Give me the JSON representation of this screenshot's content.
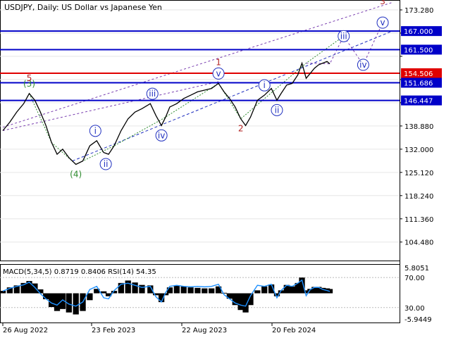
{
  "window": {
    "title": "USDJPY, Daily:  US Dollar vs Japanese Yen"
  },
  "colors": {
    "background": "#ffffff",
    "price_line": "#000000",
    "horizontal_level": "#0000c8",
    "highlight_level": "#e00000",
    "wave_red": "#b22222",
    "wave_green": "#2e8b2e",
    "wave_blue": "#1f2fbf",
    "channel_purple": "#7a3fb0",
    "macd_hist": "#000000",
    "rsi_line": "#1e90ff"
  },
  "chart_data": {
    "type": "line",
    "symbol": "USDJPY",
    "timeframe": "Daily",
    "ylim": [
      99.0,
      176.0
    ],
    "yticks": [
      173.28,
      166.4,
      159.52,
      152.64,
      145.76,
      138.88,
      132.0,
      125.12,
      118.24,
      111.36,
      104.48
    ],
    "ytick_labels": [
      "173.280",
      "167.000",
      "161.500",
      "154.506",
      "151.686",
      "146.447",
      "138.880",
      "132.000",
      "125.120",
      "118.240",
      "111.360",
      "104.480"
    ],
    "xticks": [
      "26 Aug 2022",
      "23 Feb 2023",
      "22 Aug 2023",
      "20 Feb 2024"
    ],
    "x_range": [
      0,
      470
    ],
    "series": [
      {
        "name": "USDJPY",
        "x": [
          0,
          10,
          20,
          30,
          38,
          46,
          54,
          62,
          70,
          78,
          86,
          95,
          105,
          115,
          125,
          135,
          145,
          152,
          160,
          170,
          180,
          190,
          200,
          212,
          220,
          228,
          234,
          240,
          250,
          260,
          270,
          280,
          290,
          300,
          310,
          318,
          326,
          334,
          342,
          349,
          356,
          366,
          376,
          386,
          394,
          400,
          408,
          416,
          424,
          430,
          436,
          442,
          448,
          454,
          460,
          466,
          470
        ],
        "y": [
          137.5,
          140.0,
          143.0,
          145.5,
          148.5,
          146.5,
          143.0,
          139.0,
          134.0,
          130.5,
          132.0,
          129.5,
          127.5,
          128.5,
          133.0,
          134.5,
          131.0,
          130.5,
          133.0,
          137.5,
          141.0,
          143.0,
          144.0,
          145.5,
          142.0,
          139.0,
          141.5,
          144.5,
          145.5,
          147.0,
          148.0,
          149.0,
          149.5,
          150.0,
          151.5,
          149.0,
          147.0,
          144.5,
          141.0,
          139.0,
          141.5,
          146.5,
          148.0,
          150.0,
          146.5,
          148.5,
          151.0,
          151.5,
          154.0,
          157.5,
          153.0,
          154.5,
          156.0,
          157.0,
          157.5,
          158.0,
          157.3
        ]
      }
    ],
    "levels": [
      {
        "value": 167.0,
        "label": "167.000",
        "role": "resistance"
      },
      {
        "value": 161.5,
        "label": "161.500",
        "role": "resistance"
      },
      {
        "value": 154.506,
        "label": "154.506",
        "role": "current"
      },
      {
        "value": 151.686,
        "label": "151.686",
        "role": "support"
      },
      {
        "value": 146.447,
        "label": "146.447",
        "role": "support"
      }
    ],
    "wave_labels": [
      {
        "label": "(3)",
        "x": 38,
        "y": 148.5,
        "color": "green",
        "circled": false,
        "position": "above"
      },
      {
        "label": "5",
        "x": 38,
        "y": 148.5,
        "color": "red",
        "circled": false,
        "position": "above-near"
      },
      {
        "label": "(4)",
        "x": 105,
        "y": 127.5,
        "color": "green",
        "circled": false,
        "position": "below"
      },
      {
        "label": "i",
        "x": 133,
        "y": 134.5,
        "color": "blue",
        "circled": true,
        "position": "above"
      },
      {
        "label": "ii",
        "x": 148,
        "y": 130.5,
        "color": "blue",
        "circled": true,
        "position": "below"
      },
      {
        "label": "iii",
        "x": 215,
        "y": 145.5,
        "color": "blue",
        "circled": true,
        "position": "above"
      },
      {
        "label": "iv",
        "x": 228,
        "y": 139.0,
        "color": "blue",
        "circled": true,
        "position": "below"
      },
      {
        "label": "1",
        "x": 310,
        "y": 151.5,
        "color": "red",
        "circled": false,
        "position": "above-far"
      },
      {
        "label": "v",
        "x": 310,
        "y": 151.5,
        "color": "blue",
        "circled": true,
        "position": "above"
      },
      {
        "label": "2",
        "x": 342,
        "y": 141.0,
        "color": "red",
        "circled": false,
        "position": "below"
      },
      {
        "label": "i",
        "x": 376,
        "y": 148.0,
        "color": "blue",
        "circled": true,
        "position": "above"
      },
      {
        "label": "ii",
        "x": 394,
        "y": 146.5,
        "color": "blue",
        "circled": true,
        "position": "below"
      },
      {
        "label": "iii",
        "x": 490,
        "y": 165.5,
        "color": "blue",
        "circled": true,
        "position": "projection"
      },
      {
        "label": "iv",
        "x": 518,
        "y": 157.0,
        "color": "blue",
        "circled": true,
        "position": "projection"
      },
      {
        "label": "v",
        "x": 546,
        "y": 169.5,
        "color": "blue",
        "circled": true,
        "position": "projection"
      },
      {
        "label": "3",
        "x": 546,
        "y": 169.5,
        "color": "red",
        "circled": false,
        "position": "above-far"
      }
    ],
    "indicator": {
      "label": "MACD(5,34,5) 0.8719 0.8406 RSI(14) 54.35",
      "ylim": [
        -5.9449,
        5.8051
      ],
      "ytick_labels": [
        "5.8051",
        "70.00",
        "30.00",
        "-5.9449"
      ],
      "macd_values": [
        0.5,
        1.2,
        1.6,
        2.1,
        2.5,
        2.0,
        0.8,
        -1.2,
        -2.8,
        -3.6,
        -3.2,
        -3.9,
        -4.3,
        -3.6,
        -1.4,
        0.9,
        0.4,
        -0.6,
        0.5,
        2.1,
        2.6,
        2.2,
        1.7,
        1.6,
        -0.4,
        -1.8,
        -0.4,
        1.2,
        1.5,
        1.4,
        1.2,
        1.1,
        1.0,
        1.0,
        1.4,
        0.1,
        -1.1,
        -2.4,
        -3.4,
        -3.9,
        -2.4,
        0.6,
        1.4,
        1.8,
        -0.6,
        0.6,
        1.7,
        1.4,
        2.1,
        3.2,
        0.6,
        0.9,
        1.3,
        1.3,
        1.1,
        1.0,
        0.87
      ],
      "rsi_values": [
        55,
        60,
        64,
        67,
        72,
        62,
        50,
        40,
        32,
        28,
        38,
        30,
        26,
        34,
        58,
        64,
        42,
        40,
        56,
        68,
        70,
        66,
        62,
        64,
        44,
        34,
        52,
        64,
        66,
        64,
        63,
        64,
        63,
        64,
        68,
        48,
        40,
        32,
        28,
        26,
        46,
        66,
        64,
        68,
        42,
        56,
        66,
        64,
        70,
        76,
        46,
        58,
        62,
        62,
        58,
        56,
        54.35
      ]
    }
  }
}
